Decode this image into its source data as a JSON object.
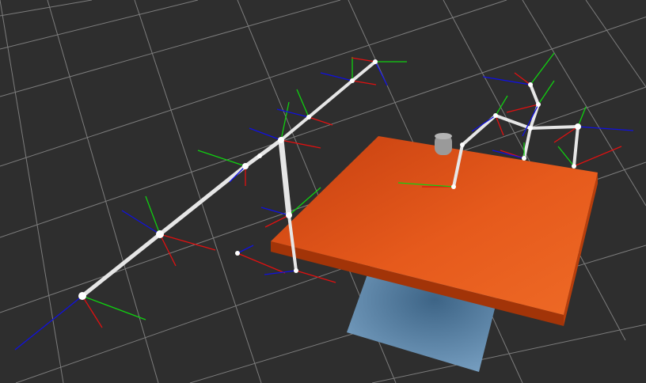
{
  "viewport": {
    "background": "#2e2e2e",
    "grid_color": "#8a8a8a"
  },
  "scene": {
    "colors": {
      "x_axis": "#e01010",
      "y_axis": "#10d010",
      "z_axis": "#1010e0",
      "link": "#e6e6e6",
      "joint": "#ffffff",
      "table_top": "#e8571a",
      "table_side": "#a6360a",
      "table_shadow": "#5f86a9",
      "gripper": "#9a9a9a"
    }
  }
}
